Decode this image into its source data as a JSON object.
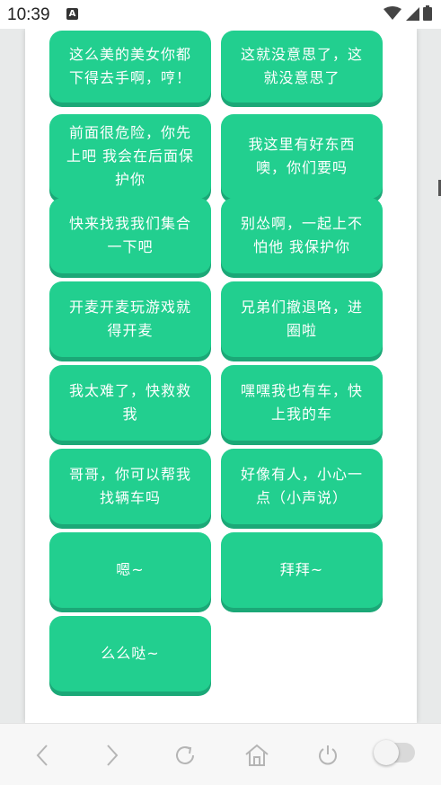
{
  "status_bar": {
    "time": "10:39",
    "notification_icon": "A"
  },
  "phrases": [
    "这么美的美女你都下得去手啊，哼！",
    "这就没意思了，这就没意思了",
    "前面很危险，你先上吧 我会在后面保护你",
    "我这里有好东西噢，你们要吗",
    "快来找我我们集合一下吧",
    "别怂啊，一起上不怕他 我保护你",
    "开麦开麦玩游戏就得开麦",
    "兄弟们撤退咯，进圈啦",
    "我太难了，快救救我",
    "嘿嘿我也有车，快上我的车",
    "哥哥，你可以帮我找辆车吗",
    "好像有人，小心一点（小声说）",
    "嗯~",
    "拜拜~",
    "么么哒~"
  ],
  "colors": {
    "button": "#22cf8f",
    "button_shadow": "#1ba877",
    "button_text": "#ffffff"
  },
  "navbar": {
    "icons": [
      "back-icon",
      "forward-icon",
      "refresh-icon",
      "home-icon",
      "power-icon",
      "toggle-switch"
    ]
  }
}
